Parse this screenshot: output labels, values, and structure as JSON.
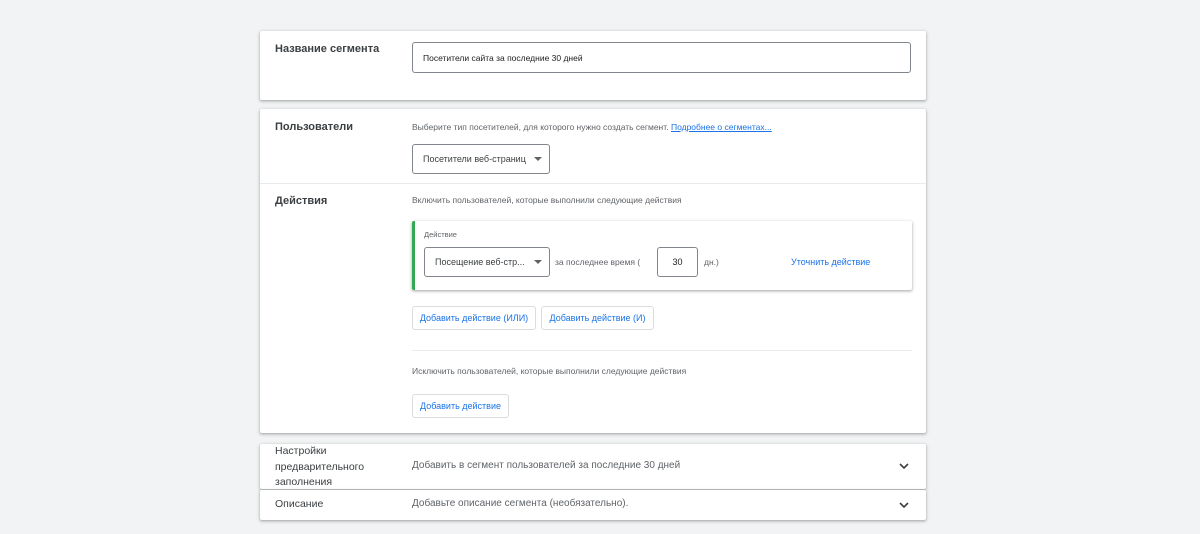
{
  "segment_name": {
    "label": "Название сегмента",
    "value": "Посетители сайта за последние 30 дней"
  },
  "users": {
    "label": "Пользователи",
    "description": "Выберите тип посетителей, для которого нужно создать сегмент.",
    "link": "Подробнее о сегментах...",
    "dropdown_value": "Посетители веб-страниц"
  },
  "actions": {
    "label": "Действия",
    "include_text": "Включить пользователей, которые выполнили следующие действия",
    "action_card": {
      "title": "Действие",
      "action_value": "Посещение веб-стр...",
      "period_prefix": "за последнее время (",
      "days_value": "30",
      "period_suffix": "дн.)",
      "refine_button": "Уточнить действие"
    },
    "add_or_button": "Добавить действие (ИЛИ)",
    "add_and_button": "Добавить действие (И)",
    "exclude_text": "Исключить пользователей, которые выполнили следующие действия",
    "add_exclude_button": "Добавить действие"
  },
  "prefill": {
    "label_line1": "Настройки",
    "label_line2": "предварительного",
    "label_line3": "заполнения",
    "summary": "Добавить в сегмент пользователей за последние 30 дней"
  },
  "description": {
    "label": "Описание",
    "summary": "Добавьте описание сегмента (необязательно)."
  },
  "colors": {
    "accent": "#1a73e8",
    "action_border": "#34a853"
  },
  "icons": {
    "dropdown": "caret-down-icon",
    "expand": "chevron-down-icon"
  }
}
